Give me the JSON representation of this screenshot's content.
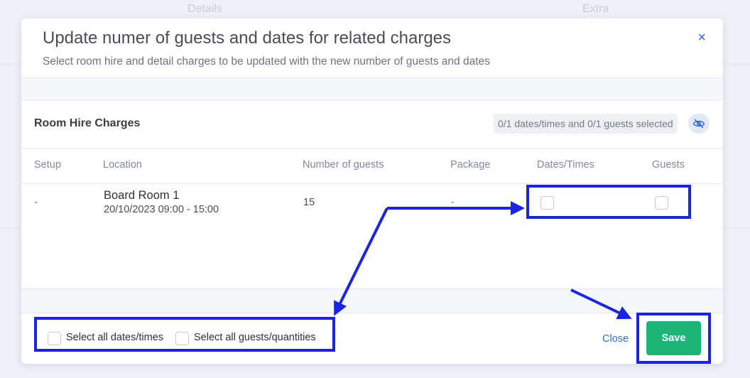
{
  "background": {
    "tab_details": "Details",
    "tab_extra": "Extra"
  },
  "modal": {
    "title": "Update numer of guests and dates for related charges",
    "subtitle": "Select room hire and detail charges to be updated with the new number of guests and dates",
    "close_icon": "×"
  },
  "section": {
    "title": "Room Hire Charges",
    "selected_text": "0/1 dates/times and 0/1 guests selected",
    "toggle_icon": "eye-slash-icon"
  },
  "table": {
    "headers": {
      "setup": "Setup",
      "location": "Location",
      "guests": "Number of guests",
      "package": "Package",
      "dates": "Dates/Times",
      "guests_col": "Guests"
    },
    "row": {
      "setup": "-",
      "location_name": "Board Room 1",
      "location_date": "20/10/2023 09:00 - 15:00",
      "guests": "15",
      "package": "-",
      "dates_checked": false,
      "guests_checked": false
    }
  },
  "footer": {
    "select_all_dates": "Select all dates/times",
    "select_all_guests": "Select all guests/quantities",
    "close": "Close",
    "save": "Save"
  },
  "colors": {
    "accent": "#2f6fd6",
    "save": "#1db577",
    "annotation": "#1a23e6"
  }
}
